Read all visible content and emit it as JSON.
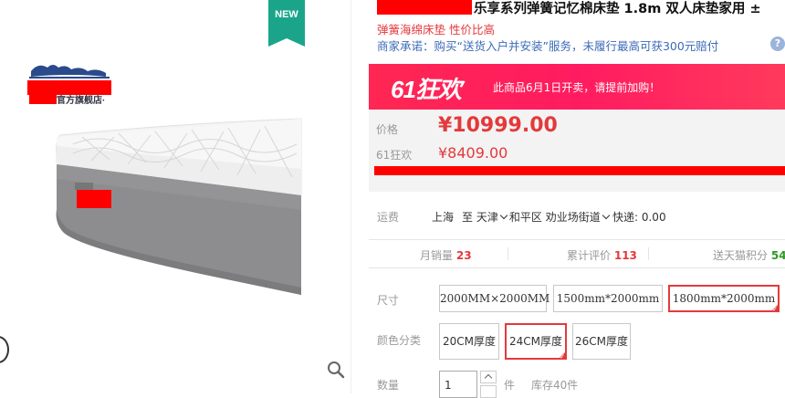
{
  "gallery": {
    "new_badge": "NEW",
    "brand_caption": "官方旗舰店·"
  },
  "product": {
    "title": "乐享系列弹簧记忆棉床垫 1.8m 双人床垫家用 ±",
    "subtitle": "弹簧海绵床垫 性价比高",
    "promise": "商家承诺：购买“送货入户并安装”服务，未履行最高可获300元赔付",
    "help_glyph": "?"
  },
  "promo": {
    "logo": "61狂欢",
    "text": "此商品6月1日开卖，请提前加购！"
  },
  "price": {
    "label": "价格",
    "value": "¥10999.00",
    "promo_label": "61狂欢",
    "promo_value": "¥8409.00"
  },
  "shipping": {
    "label": "运费",
    "from": "上海",
    "to_prefix": "至",
    "city": "天津",
    "district": "和平区",
    "street": "劝业场街道",
    "fee": "快递: 0.00"
  },
  "stats": {
    "monthly_sales_label": "月销量",
    "monthly_sales_value": "23",
    "reviews_label": "累计评价",
    "reviews_value": "113",
    "points_label": "送天猫积分",
    "points_value": "54"
  },
  "options": {
    "size_label": "尺寸",
    "sizes": [
      "2000MM×2000MM",
      "1500mm*2000mm",
      "1800mm*2000mm"
    ],
    "selected_size": "1800mm*2000mm",
    "color_label": "颜色分类",
    "colors": [
      "20CM厚度",
      "24CM厚度",
      "26CM厚度"
    ],
    "selected_color": "24CM厚度"
  },
  "quantity": {
    "label": "数量",
    "value": "1",
    "unit": "件",
    "stock": "库存40件"
  },
  "colors": {
    "accent": "#e4393c",
    "link": "#3c6bb8",
    "badge": "#1aa58a",
    "banner": "#ff1f5a",
    "green": "#2d9a22"
  }
}
